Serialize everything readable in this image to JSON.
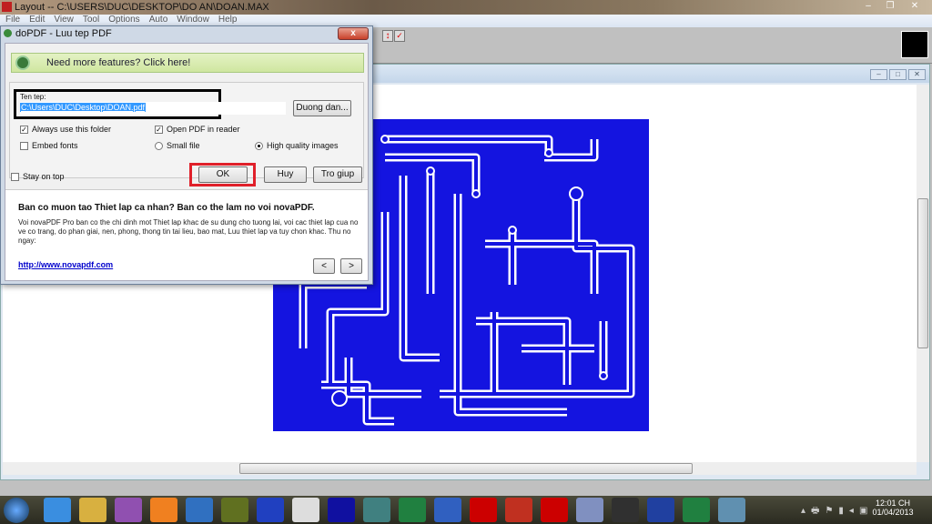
{
  "app": {
    "title": "Layout -- C:\\USERS\\DUC\\DESKTOP\\DO AN\\DOAN.MAX",
    "menu": [
      "File",
      "Edit",
      "View",
      "Tool",
      "Options",
      "Auto",
      "Window",
      "Help"
    ]
  },
  "dialog": {
    "title": "doPDF - Luu tep PDF",
    "close": "x",
    "banner": "Need more features? Click here!",
    "filename_label": "Ten tep:",
    "filename_value": "C:\\Users\\DUC\\Desktop\\DOAN.pdf",
    "browse_button": "Duong dan...",
    "always_use_folder": {
      "label": "Always use this folder",
      "checked": true
    },
    "open_pdf": {
      "label": "Open PDF in reader",
      "checked": true
    },
    "embed_fonts": {
      "label": "Embed fonts",
      "checked": false
    },
    "small_file": {
      "label": "Small file",
      "selected": false
    },
    "high_quality": {
      "label": "High quality images",
      "selected": true
    },
    "stay_on_top": {
      "label": "Stay on top",
      "checked": false
    },
    "ok": "OK",
    "cancel": "Huy",
    "help": "Tro giup",
    "promo_title": "Ban co muon tao Thiet lap ca nhan? Ban co the lam no voi novaPDF.",
    "promo_text": "Voi novaPDF Pro ban co the chi dinh mot Thiet lap khac de su dung cho tuong lai, voi cac thiet lap cua no ve co trang, do phan giai, nen, phong, thong tin tai lieu, bao mat, Luu thiet lap va tuy chon khac. Thu no ngay:",
    "link": "http://www.novapdf.com",
    "prev": "<",
    "next": ">"
  },
  "taskbar": {
    "apps": [
      "IE",
      "Files",
      "Chat",
      "VLC",
      "Paint",
      "Chip",
      "V4",
      "Chrome",
      "ISIS",
      "App",
      "Layout",
      "Word",
      "CV AVR",
      "CCleaner",
      "ARES",
      "Calc",
      "Tool",
      "HDL A",
      "Layout",
      "Paint"
    ],
    "time": "12:01 CH",
    "date": "01/04/2013"
  },
  "colors": {
    "pcb": "#1414e0",
    "highlight": "#e0202a"
  }
}
